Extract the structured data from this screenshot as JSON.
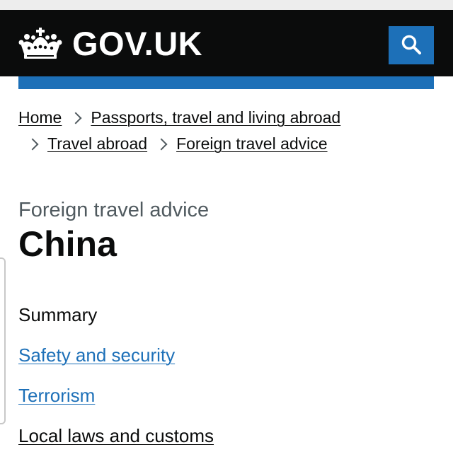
{
  "header": {
    "logo_text": "GOV.UK",
    "search_icon": "search-icon",
    "crown_icon": "crown-icon",
    "background": "#0b0c0c",
    "accent": "#1d70b8"
  },
  "breadcrumbs": [
    {
      "label": "Home"
    },
    {
      "label": "Passports, travel and living abroad"
    },
    {
      "label": "Travel abroad"
    },
    {
      "label": "Foreign travel advice"
    }
  ],
  "page": {
    "caption": "Foreign travel advice",
    "title": "China"
  },
  "contents": [
    {
      "label": "Summary",
      "current": true
    },
    {
      "label": "Safety and security"
    },
    {
      "label": "Terrorism"
    },
    {
      "label": "Local laws and customs"
    }
  ]
}
